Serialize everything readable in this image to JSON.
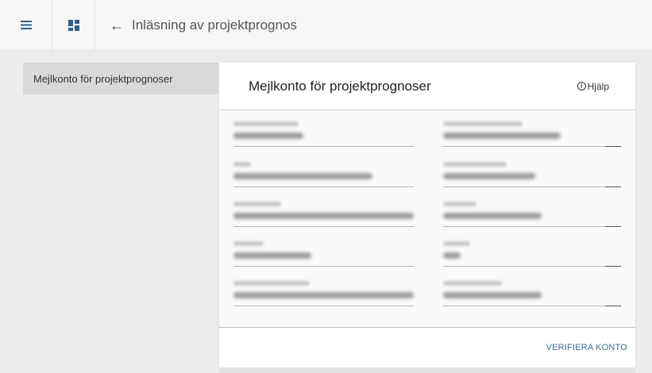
{
  "topbar": {
    "menu_icon": "hamburger-menu-icon",
    "grid_icon": "dashboard-grid-icon",
    "back_icon": "arrow-left-icon",
    "title": "Inläsning av projektprognos"
  },
  "nav": {
    "items": [
      {
        "label": "Mejlkonto för projektprognoser",
        "selected": true
      }
    ]
  },
  "card": {
    "title": "Mejlkonto för projektprognoser",
    "help_label": "Hjälp",
    "help_icon": "info-circle-icon",
    "fields_note": "Field labels and values are blurred and unreadable in the screenshot",
    "verify_label": "VERIFIERA KONTO"
  },
  "colors": {
    "accent": "#3d6d99",
    "nav_selected_bg": "#d9d9d9",
    "page_bg": "#ececec"
  }
}
